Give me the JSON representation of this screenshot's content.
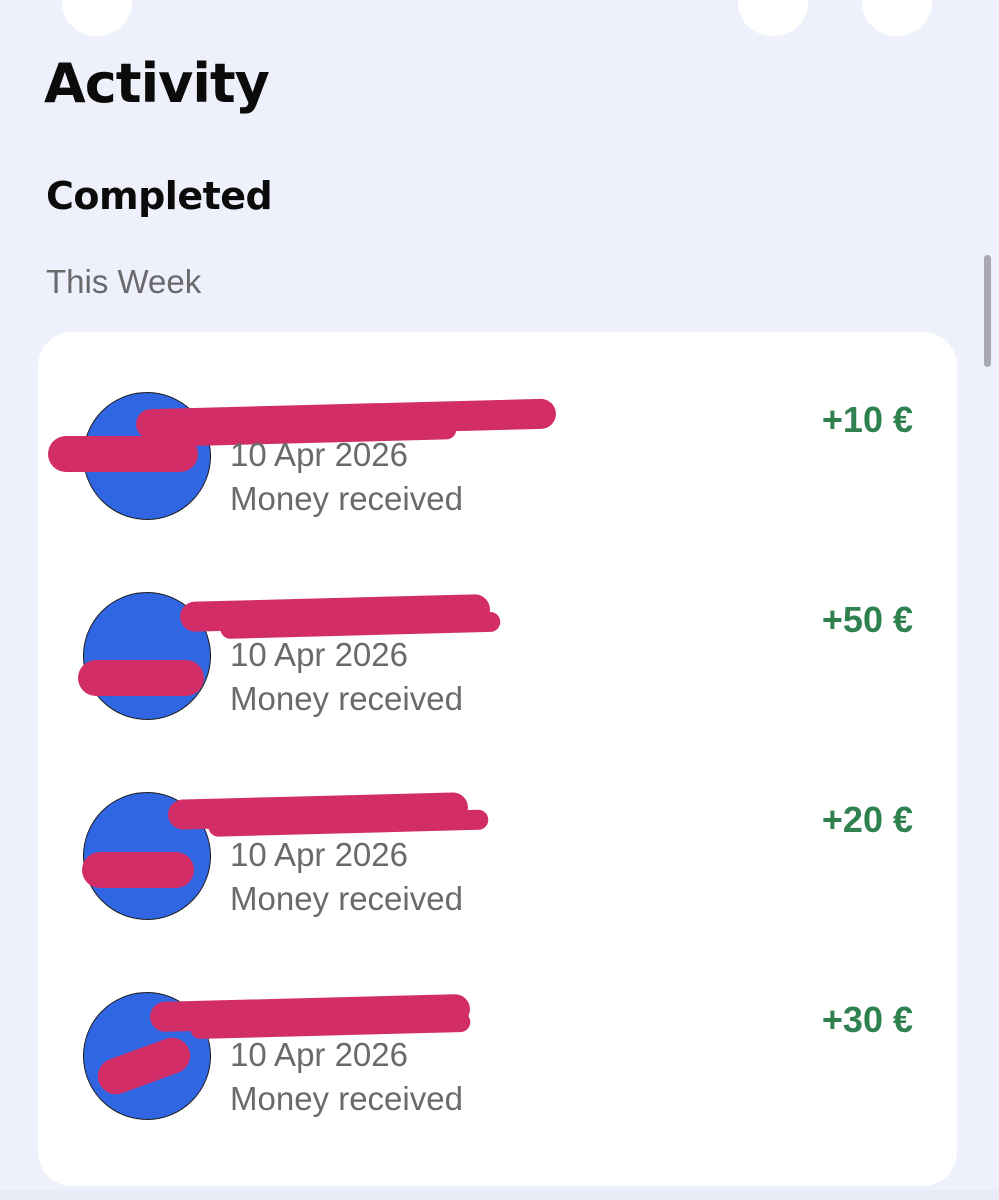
{
  "header": {
    "title": "Activity"
  },
  "section": {
    "title": "Completed",
    "group_label": "This Week"
  },
  "transactions": [
    {
      "date": "10 Apr 2026",
      "status": "Money received",
      "amount": "+10 €"
    },
    {
      "date": "10 Apr 2026",
      "status": "Money received",
      "amount": "+50 €"
    },
    {
      "date": "10 Apr 2026",
      "status": "Money received",
      "amount": "+20 €"
    },
    {
      "date": "10 Apr 2026",
      "status": "Money received",
      "amount": "+30 €"
    }
  ],
  "colors": {
    "background": "#eef1fb",
    "card": "#ffffff",
    "avatar": "#3066e2",
    "amount_positive": "#2f8250",
    "secondary_text": "#6a6a6c",
    "redaction": "#d22d67"
  }
}
